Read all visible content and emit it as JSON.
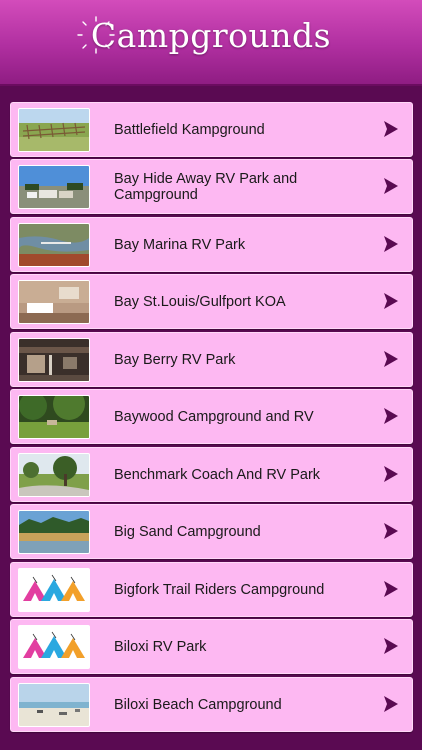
{
  "header": {
    "title": "Campgrounds",
    "background": "#b02fa0"
  },
  "list": {
    "items": [
      {
        "label": "Battlefield Kampground",
        "thumb": "field-fence-photo"
      },
      {
        "label": "Bay Hide Away RV Park and Campground",
        "thumb": "rv-lot-photo"
      },
      {
        "label": "Bay Marina RV Park",
        "thumb": "marina-aerial-photo"
      },
      {
        "label": "Bay St.Louis/Gulfport KOA",
        "thumb": "cabin-interior-photo"
      },
      {
        "label": "Bay Berry RV Park",
        "thumb": "lodge-porch-photo"
      },
      {
        "label": "Baywood Campground and RV",
        "thumb": "wooded-lawn-photo"
      },
      {
        "label": "Benchmark Coach And RV Park",
        "thumb": "tree-lot-photo"
      },
      {
        "label": "Big Sand Campground",
        "thumb": "lake-forest-photo"
      },
      {
        "label": "Bigfork Trail Riders Campground",
        "thumb": "tents-icon"
      },
      {
        "label": "Biloxi RV Park",
        "thumb": "tents-icon"
      },
      {
        "label": "Biloxi Beach Campground",
        "thumb": "beach-photo"
      }
    ],
    "row_color": "#fdb8f2",
    "arrow_color": "#5a0a52"
  }
}
